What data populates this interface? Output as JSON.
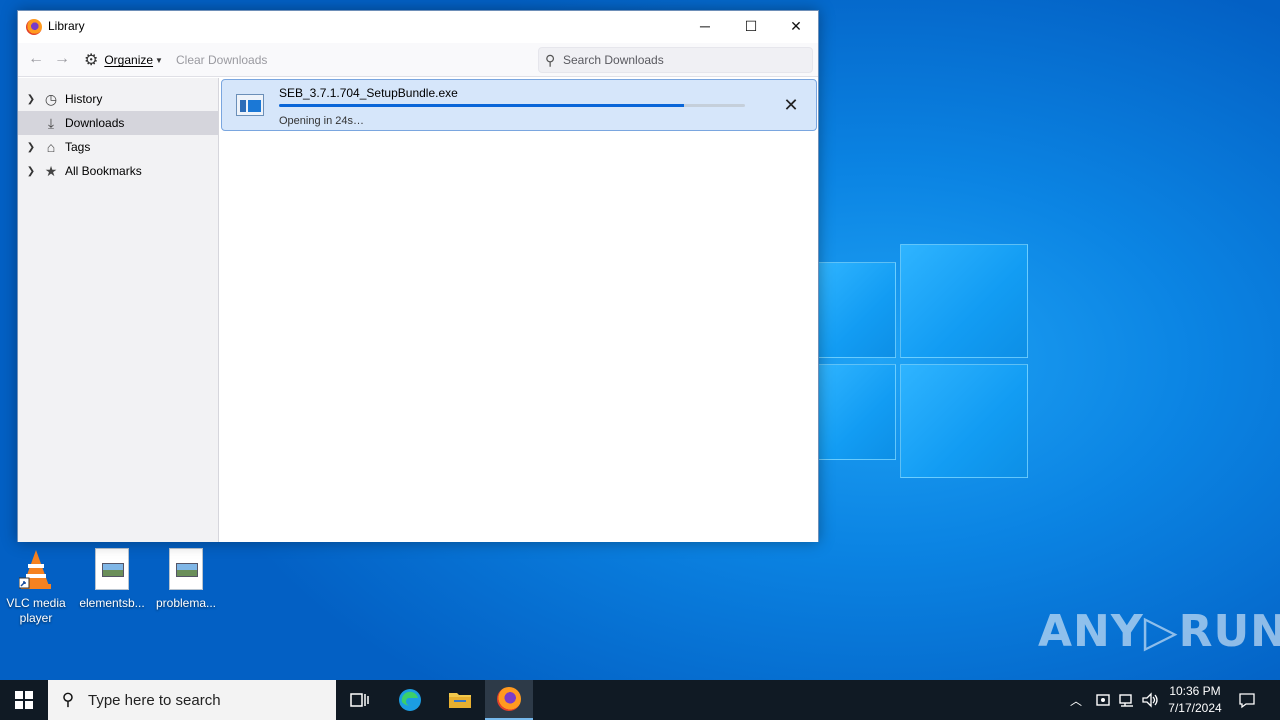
{
  "window": {
    "title": "Library",
    "minimize_glyph": "─",
    "maximize_glyph": "☐",
    "close_glyph": "✕"
  },
  "toolbar": {
    "back_glyph": "←",
    "forward_glyph": "→",
    "organize_label": "Organize",
    "clear_downloads_label": "Clear Downloads",
    "search_placeholder": "Search Downloads"
  },
  "sidebar": {
    "items": [
      {
        "label": "History",
        "icon": "clock-icon",
        "expandable": true,
        "selected": false
      },
      {
        "label": "Downloads",
        "icon": "download-icon",
        "expandable": false,
        "selected": true
      },
      {
        "label": "Tags",
        "icon": "tag-icon",
        "expandable": true,
        "selected": false
      },
      {
        "label": "All Bookmarks",
        "icon": "star-icon",
        "expandable": true,
        "selected": false
      }
    ]
  },
  "downloads": [
    {
      "filename": "SEB_3.7.1.704_SetupBundle.exe",
      "status": "Opening in 24s…",
      "progress": 0.87,
      "cancel_glyph": "✕"
    }
  ],
  "desktop": {
    "icons": [
      {
        "label": "VLC media player",
        "type": "vlc"
      },
      {
        "label": "elementsb...",
        "type": "file"
      },
      {
        "label": "problema...",
        "type": "file"
      }
    ],
    "watermark": "ANY▷RUN"
  },
  "taskbar": {
    "search_placeholder": "Type here to search",
    "time": "10:36 PM",
    "date": "7/17/2024",
    "accent": "#0078d7"
  }
}
